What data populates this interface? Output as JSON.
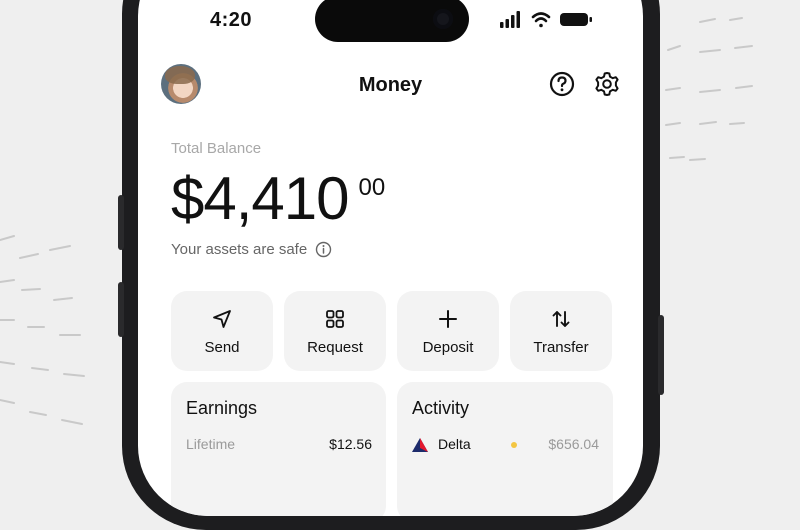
{
  "status": {
    "time": "4:20"
  },
  "header": {
    "title": "Money",
    "avatar": "user-avatar",
    "icons": [
      "help-icon",
      "settings-icon"
    ]
  },
  "balance": {
    "label": "Total Balance",
    "amount": "$4,410",
    "cents": "00",
    "safe_text": "Your assets are safe"
  },
  "actions": [
    {
      "label": "Send",
      "icon": "send-icon"
    },
    {
      "label": "Request",
      "icon": "request-icon"
    },
    {
      "label": "Deposit",
      "icon": "plus-icon"
    },
    {
      "label": "Transfer",
      "icon": "transfer-icon"
    }
  ],
  "earnings": {
    "title": "Earnings",
    "rows": [
      {
        "label": "Lifetime",
        "value": "$12.56"
      }
    ]
  },
  "activity": {
    "title": "Activity",
    "rows": [
      {
        "name": "Delta",
        "value": "$656.04",
        "status_color": "#f3c642"
      }
    ]
  },
  "colors": {
    "background": "#efefef",
    "card": "#f3f3f3",
    "frame": "#1d1d1f",
    "accent_dot": "#f3c642"
  }
}
